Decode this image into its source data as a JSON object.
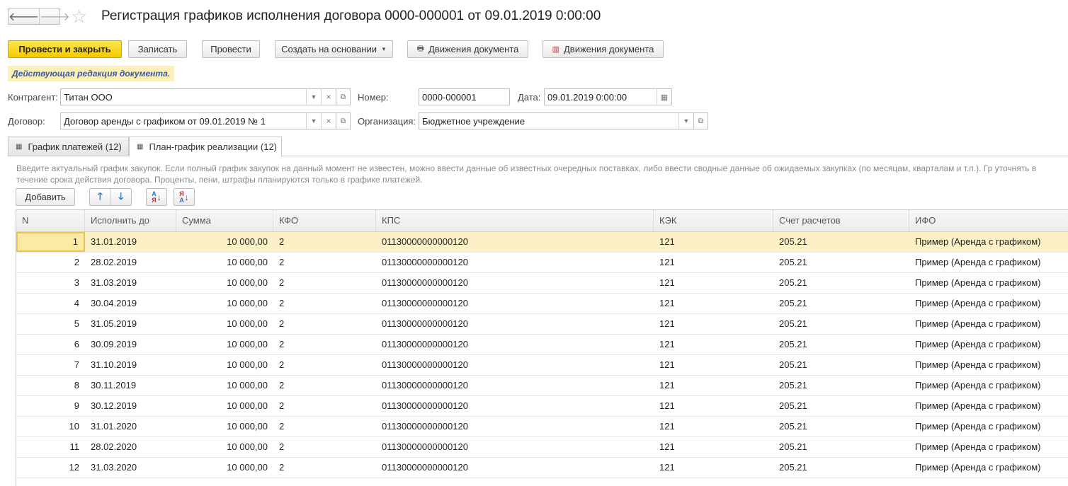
{
  "nav": {
    "back_glyph": "🡐",
    "forward_glyph": "🡒"
  },
  "window": {
    "title": "Регистрация графиков исполнения договора 0000-000001 от 09.01.2019 0:00:00"
  },
  "toolbar": {
    "post_close_label": "Провести и закрыть",
    "save_label": "Записать",
    "post_label": "Провести",
    "create_based_label": "Создать на основании",
    "movements1_label": "Движения документа",
    "movements2_label": "Движения документа"
  },
  "banner": {
    "text": "Действующая редакция документа."
  },
  "form": {
    "contractor_label": "Контрагент:",
    "contractor_value": "Титан ООО",
    "number_label": "Номер:",
    "number_value": "0000-000001",
    "date_label": "Дата:",
    "date_value": "09.01.2019  0:00:00",
    "contract_label": "Договор:",
    "contract_value": "Договор аренды с графиком от 09.01.2019 № 1",
    "org_label": "Организация:",
    "org_value": "Бюджетное учреждение"
  },
  "tabs": [
    {
      "label": "График платежей (12)"
    },
    {
      "label": "План-график реализации (12)"
    }
  ],
  "hint": {
    "text": "Введите актуальный график закупок. Если полный график закупок на данный момент не известен, можно ввести данные об известных очередных поставках, либо ввести сводные данные об ожидаемых закупках (по месяцам, кварталам и т.п.). Гр уточнять в течение срока действия договора. Проценты, пени, штрафы планируются только в графике платежей."
  },
  "table_toolbar": {
    "add_label": "Добавить"
  },
  "table": {
    "columns": [
      "N",
      "Исполнить до",
      "Сумма",
      "КФО",
      "КПС",
      "КЭК",
      "Счет расчетов",
      "ИФО"
    ],
    "rows": [
      [
        "1",
        "31.01.2019",
        "10 000,00",
        "2",
        "01130000000000120",
        "121",
        "205.21",
        "Пример (Аренда с графиком)"
      ],
      [
        "2",
        "28.02.2019",
        "10 000,00",
        "2",
        "01130000000000120",
        "121",
        "205.21",
        "Пример (Аренда с графиком)"
      ],
      [
        "3",
        "31.03.2019",
        "10 000,00",
        "2",
        "01130000000000120",
        "121",
        "205.21",
        "Пример (Аренда с графиком)"
      ],
      [
        "4",
        "30.04.2019",
        "10 000,00",
        "2",
        "01130000000000120",
        "121",
        "205.21",
        "Пример (Аренда с графиком)"
      ],
      [
        "5",
        "31.05.2019",
        "10 000,00",
        "2",
        "01130000000000120",
        "121",
        "205.21",
        "Пример (Аренда с графиком)"
      ],
      [
        "6",
        "30.09.2019",
        "10 000,00",
        "2",
        "01130000000000120",
        "121",
        "205.21",
        "Пример (Аренда с графиком)"
      ],
      [
        "7",
        "31.10.2019",
        "10 000,00",
        "2",
        "01130000000000120",
        "121",
        "205.21",
        "Пример (Аренда с графиком)"
      ],
      [
        "8",
        "30.11.2019",
        "10 000,00",
        "2",
        "01130000000000120",
        "121",
        "205.21",
        "Пример (Аренда с графиком)"
      ],
      [
        "9",
        "30.12.2019",
        "10 000,00",
        "2",
        "01130000000000120",
        "121",
        "205.21",
        "Пример (Аренда с графиком)"
      ],
      [
        "10",
        "31.01.2020",
        "10 000,00",
        "2",
        "01130000000000120",
        "121",
        "205.21",
        "Пример (Аренда с графиком)"
      ],
      [
        "11",
        "28.02.2020",
        "10 000,00",
        "2",
        "01130000000000120",
        "121",
        "205.21",
        "Пример (Аренда с графиком)"
      ],
      [
        "12",
        "31.03.2020",
        "10 000,00",
        "2",
        "01130000000000120",
        "121",
        "205.21",
        "Пример (Аренда с графиком)"
      ]
    ]
  }
}
